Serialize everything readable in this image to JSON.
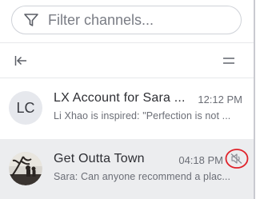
{
  "filter": {
    "placeholder": "Filter channels..."
  },
  "toolbar": {
    "collapse_icon": "collapse-left-icon",
    "menu_icon": "hamburger-menu-icon"
  },
  "channels": [
    {
      "avatar_text": "LC",
      "name": "LX Account for Sara ...",
      "time": "12:12 PM",
      "preview": "Li Xhao is inspired: \"Perfection is not ...",
      "selected": false
    },
    {
      "avatar_icon": "group-photo-avatar",
      "name": "Get Outta Town",
      "time": "04:18 PM",
      "preview": "Sara: Can anyone recommend a plac...",
      "selected": true,
      "muted_icon": "muted-speaker-icon"
    }
  ],
  "colors": {
    "accent_highlight": "#e0222a",
    "selected_row_bg": "#ecedef"
  }
}
